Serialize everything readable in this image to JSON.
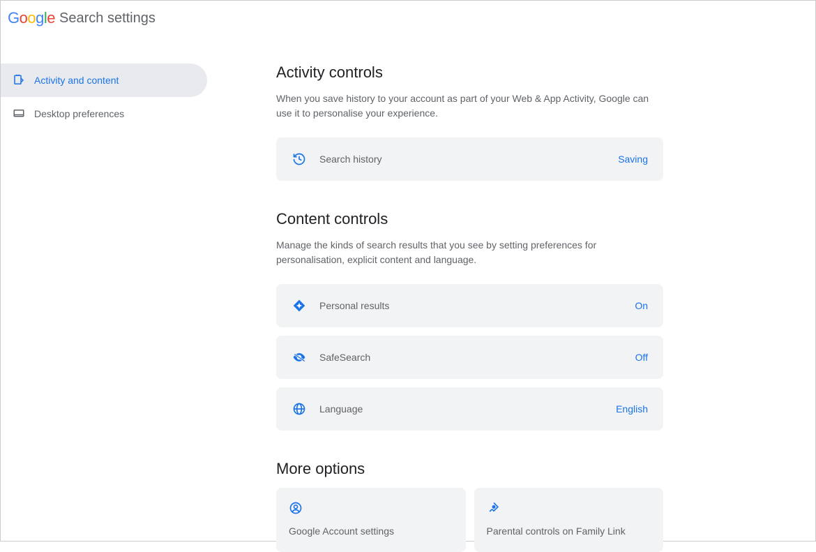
{
  "header": {
    "title": "Search settings"
  },
  "sidebar": {
    "items": [
      {
        "label": "Activity and content"
      },
      {
        "label": "Desktop preferences"
      }
    ]
  },
  "sections": {
    "activity": {
      "title": "Activity controls",
      "desc": "When you save history to your account as part of your Web & App Activity, Google can use it to personalise your experience.",
      "searchHistory": {
        "label": "Search history",
        "value": "Saving"
      }
    },
    "content": {
      "title": "Content controls",
      "desc": "Manage the kinds of search results that you see by setting preferences for personalisation, explicit content and language.",
      "personalResults": {
        "label": "Personal results",
        "value": "On"
      },
      "safeSearch": {
        "label": "SafeSearch",
        "value": "Off"
      },
      "language": {
        "label": "Language",
        "value": "English"
      }
    },
    "more": {
      "title": "More options",
      "account": {
        "label": "Google Account settings"
      },
      "parental": {
        "label": "Parental controls on Family Link"
      }
    }
  }
}
